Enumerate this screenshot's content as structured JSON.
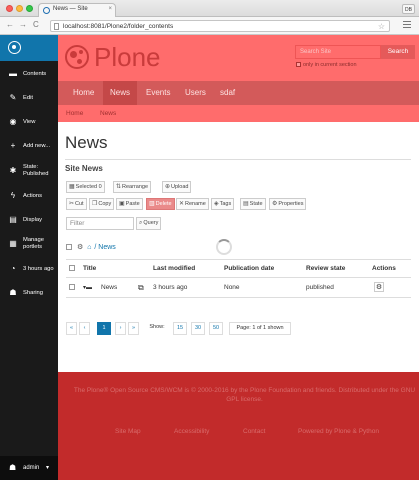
{
  "browser": {
    "tab_title": "News — Site",
    "tab_close": "×",
    "profile_badge": "DB",
    "url": "localhost:8081/Plone2/folder_contents",
    "nav_back": "←",
    "nav_forward": "→",
    "nav_reload": "C",
    "bookmark_star": "☆"
  },
  "sidebar": {
    "items": [
      {
        "label": "Contents",
        "icon": "folder-icon",
        "glyph": "▬"
      },
      {
        "label": "Edit",
        "icon": "pencil-icon",
        "glyph": "✎"
      },
      {
        "label": "View",
        "icon": "eye-icon",
        "glyph": "◉"
      },
      {
        "label": "Add new...",
        "icon": "plus-icon",
        "glyph": "+"
      },
      {
        "label": "State: Published",
        "icon": "state-icon",
        "glyph": "✱"
      },
      {
        "label": "Actions",
        "icon": "bolt-icon",
        "glyph": "ϟ"
      },
      {
        "label": "Display",
        "icon": "display-icon",
        "glyph": "▤"
      },
      {
        "label": "Manage portlets",
        "icon": "portlets-icon",
        "glyph": "▦"
      },
      {
        "label": "3 hours ago",
        "icon": "clock-icon",
        "glyph": "◔"
      },
      {
        "label": "Sharing",
        "icon": "users-icon",
        "glyph": "☗"
      }
    ],
    "admin_label": "admin",
    "admin_caret": "▾"
  },
  "header": {
    "logo_text": "Plone",
    "search_placeholder": "Search Site",
    "search_button": "Search",
    "only_current": "only in current section"
  },
  "nav": {
    "tabs": [
      "Home",
      "News",
      "Events",
      "Users",
      "sdaf"
    ],
    "active": "News"
  },
  "breadcrumbs": [
    "Home",
    "News"
  ],
  "content": {
    "title": "News",
    "section": "Site News",
    "toolbar1": {
      "selected": "Selected 0",
      "rearrange": "Rearrange",
      "upload": "Upload"
    },
    "toolbar2": [
      "Cut",
      "Copy",
      "Paste",
      "Delete",
      "Rename",
      "Tags",
      "State",
      "Properties"
    ],
    "filter_placeholder": "Filter",
    "query_button": "Query",
    "path_label": "/ News",
    "columns": [
      "Title",
      "Last modified",
      "Publication date",
      "Review state",
      "Actions"
    ],
    "rows": [
      {
        "title": "News",
        "modified": "3 hours ago",
        "published": "None",
        "state": "published"
      }
    ],
    "pager": {
      "first": "«",
      "prev": "‹",
      "page": "1",
      "next": "›",
      "last": "»",
      "show_label": "Show:",
      "sizes": [
        "15",
        "30",
        "50"
      ],
      "status": "Page: 1 of 1 shown"
    }
  },
  "footer": {
    "text": "The Plone® Open Source CMS/WCM is © 2000-2016 by the Plone Foundation and friends. Distributed under the GNU GPL license.",
    "links": [
      "Site Map",
      "Accessibility",
      "Contact",
      "Powered by Plone & Python"
    ]
  }
}
